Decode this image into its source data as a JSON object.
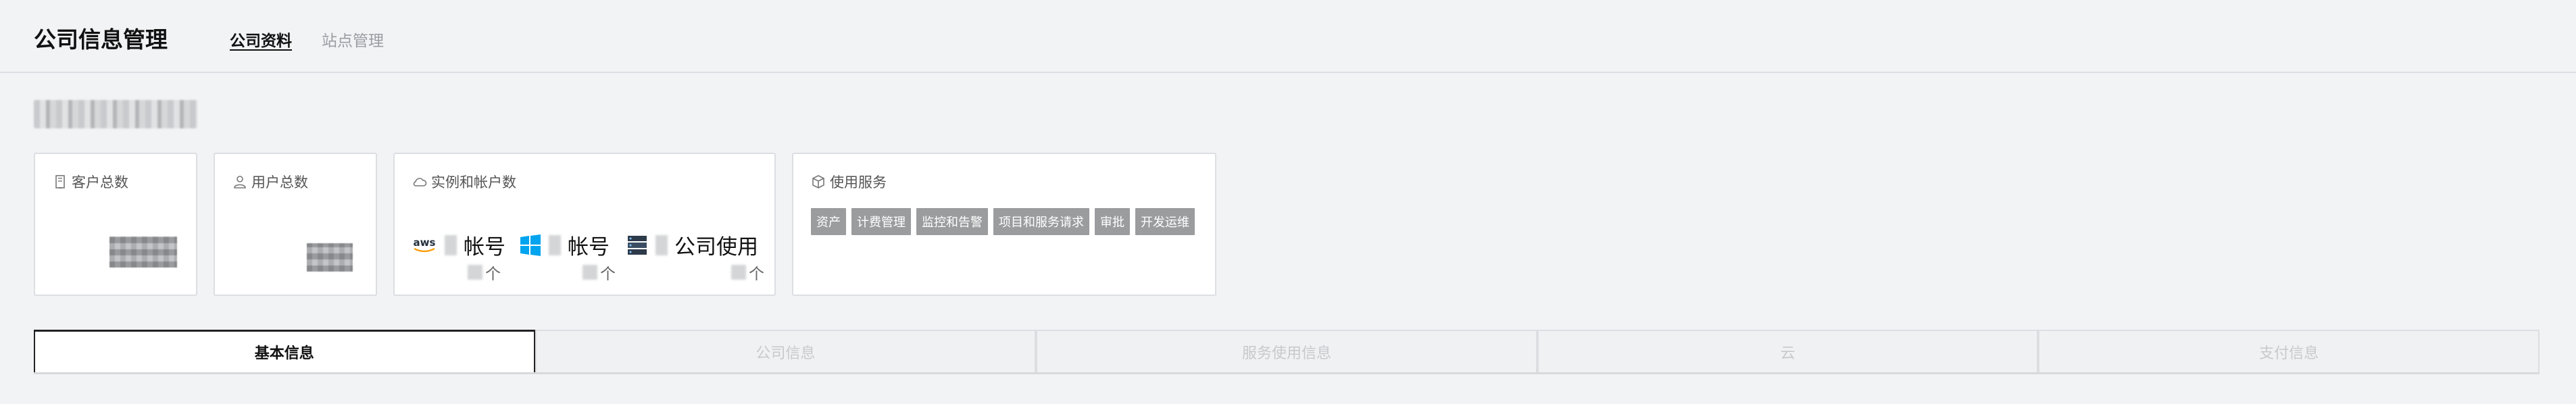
{
  "header": {
    "title": "公司信息管理",
    "nav": [
      {
        "label": "公司资料",
        "active": true
      },
      {
        "label": "站点管理",
        "active": false
      }
    ]
  },
  "cards": {
    "customers": {
      "title": "客户总数",
      "icon": "building-icon"
    },
    "users": {
      "title": "用户总数",
      "icon": "user-icon"
    },
    "instances": {
      "title": "实例和帐户数",
      "icon": "cloud-icon",
      "aws": {
        "label": "帐号",
        "logo_text": "aws",
        "unit": "个"
      },
      "azure": {
        "label": "帐号",
        "unit": "个"
      },
      "company": {
        "label": "公司使用",
        "unit": "个"
      }
    },
    "services": {
      "title": "使用服务",
      "icon": "cube-icon",
      "tags": [
        "资产",
        "计费管理",
        "监控和告警",
        "项目和服务请求",
        "审批",
        "开发运维"
      ]
    }
  },
  "tabs": [
    {
      "label": "基本信息",
      "active": true
    },
    {
      "label": "公司信息",
      "active": false
    },
    {
      "label": "服务使用信息",
      "active": false
    },
    {
      "label": "云",
      "active": false
    },
    {
      "label": "支付信息",
      "active": false
    }
  ],
  "colors": {
    "aws_orange": "#ff9900",
    "azure_blue": "#00a4ef",
    "tag_gray": "#9b9c9e"
  }
}
